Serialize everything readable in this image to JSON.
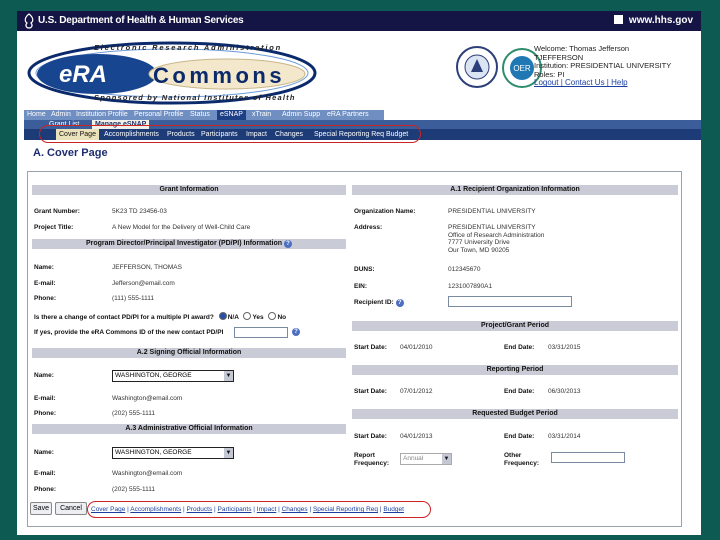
{
  "hhs_bar": {
    "title": "U.S. Department of Health & Human Services",
    "url": "www.hhs.gov"
  },
  "banner": {
    "line1": "Electronic Research Administration",
    "era": "eRA",
    "commons": "Commons",
    "line3": "Sponsored by National Institutes of Health",
    "seal1_text": "NATIONAL INSTITUTES OF HEALTH",
    "seal2_text": "OER",
    "welcome": "Welcome: Thomas Jefferson",
    "welcome2": "TJEFFERSON",
    "institution": "Institution: PRESIDENTIAL UNIVERSITY",
    "roles": "Roles: PI",
    "links": "Logout | Contact Us | Help"
  },
  "tabs": [
    {
      "label": "Home"
    },
    {
      "label": "Admin"
    },
    {
      "label": "Institution Profile"
    },
    {
      "label": "Personal Profile"
    },
    {
      "label": "Status"
    },
    {
      "label": "eSNAP"
    },
    {
      "label": "xTrain"
    },
    {
      "label": "Admin Supp"
    },
    {
      "label": "eRA Partners"
    }
  ],
  "subnav": [
    {
      "label": "Grant List"
    },
    {
      "label": "Manage eSNAP"
    }
  ],
  "sections": [
    {
      "label": "Cover Page"
    },
    {
      "label": "Accomplishments"
    },
    {
      "label": "Products"
    },
    {
      "label": "Participants"
    },
    {
      "label": "Impact"
    },
    {
      "label": "Changes"
    },
    {
      "label": "Special Reporting Req"
    },
    {
      "label": "Budget"
    }
  ],
  "page_title": "A. Cover Page",
  "grant": {
    "header": "Grant Information",
    "number_label": "Grant Number:",
    "number_value": "5K23 TD 23456-03",
    "title_label": "Project Title:",
    "title_value": "A New Model for the Delivery of Well-Child Care"
  },
  "pd": {
    "header": "Program Director/Principal Investigator (PD/PI) Information",
    "name_label": "Name:",
    "name_value": "JEFFERSON, THOMAS",
    "email_label": "E-mail:",
    "email_value": "Jefferson@email.com",
    "phone_label": "Phone:",
    "phone_value": "(111) 555-1111",
    "change_q": "Is there a change of contact PD/PI for a multiple PI award?",
    "opt_na": "N/A",
    "opt_yes": "Yes",
    "opt_no": "No",
    "commons_q": "If yes, provide the eRA Commons ID of the new contact PD/PI"
  },
  "so": {
    "header": "A.2 Signing Official Information",
    "name_label": "Name:",
    "name_value": "WASHINGTON, GEORGE",
    "email_label": "E-mail:",
    "email_value": "Washington@email.com",
    "phone_label": "Phone:",
    "phone_value": "(202) 555-1111"
  },
  "ao": {
    "header": "A.3 Administrative Official Information",
    "name_label": "Name:",
    "name_value": "WASHINGTON, GEORGE",
    "email_label": "E-mail:",
    "email_value": "Washington@email.com",
    "phone_label": "Phone:",
    "phone_value": "(202) 555-1111"
  },
  "org": {
    "header": "A.1 Recipient Organization Information",
    "name_label": "Organization Name:",
    "name_value": "PRESIDENTIAL UNIVERSITY",
    "address_label": "Address:",
    "address_lines": [
      "PRESIDENTIAL UNIVERSITY",
      "Office of Research Administration",
      "7777 University Drive",
      "Our Town, MD 90205"
    ],
    "duns_label": "DUNS:",
    "duns_value": "012345670",
    "ein_label": "EIN:",
    "ein_value": "1231007890A1",
    "rid_label": "Recipient ID:"
  },
  "pgp": {
    "header": "Project/Grant Period",
    "start_label": "Start Date:",
    "start_value": "04/01/2010",
    "end_label": "End Date:",
    "end_value": "03/31/2015"
  },
  "rp": {
    "header": "Reporting Period",
    "start_label": "Start Date:",
    "start_value": "07/01/2012",
    "end_label": "End Date:",
    "end_value": "06/30/2013"
  },
  "rbp": {
    "header": "Requested Budget Period",
    "start_label": "Start Date:",
    "start_value": "04/01/2013",
    "end_label": "End Date:",
    "end_value": "03/31/2014",
    "freq_label": "Report Frequency:",
    "freq_value": "Annual",
    "other_label": "Other Frequency:"
  },
  "buttons": {
    "save": "Save",
    "cancel": "Cancel"
  },
  "bottom_links": [
    "Cover Page",
    "Accomplishments",
    "Products",
    "Participants",
    "Impact",
    "Changes",
    "Special Reporting Req",
    "Budget"
  ],
  "colors": {
    "background": "#0c5a52",
    "accent_navy": "#1d3b76",
    "section_grey": "#c9ccd6",
    "highlight_oval": "#cc2222"
  }
}
